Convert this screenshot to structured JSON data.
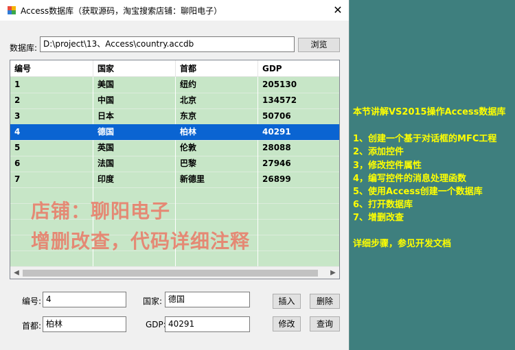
{
  "window": {
    "title": "Access数据库（获取源码，淘宝搜索店铺：聊阳电子）",
    "close_icon": "close-icon"
  },
  "db": {
    "label": "数据库:",
    "path": "D:\\project\\13、Access\\country.accdb",
    "browse_label": "浏览"
  },
  "table": {
    "columns": [
      "编号",
      "国家",
      "首都",
      "GDP"
    ],
    "rows": [
      [
        "1",
        "美国",
        "纽约",
        "205130"
      ],
      [
        "2",
        "中国",
        "北京",
        "134572"
      ],
      [
        "3",
        "日本",
        "东京",
        "50706"
      ],
      [
        "4",
        "德国",
        "柏林",
        "40291"
      ],
      [
        "5",
        "英国",
        "伦敦",
        "28088"
      ],
      [
        "6",
        "法国",
        "巴黎",
        "27946"
      ],
      [
        "7",
        "印度",
        "新德里",
        "26899"
      ]
    ],
    "selected_row": 4,
    "watermark_1": "店铺：聊阳电子",
    "watermark_2": "增删改查，代码详细注释"
  },
  "form": {
    "id_label": "编号:",
    "id_value": "4",
    "country_label": "国家:",
    "country_value": "德国",
    "capital_label": "首都:",
    "capital_value": "柏林",
    "gdp_label": "GDP:",
    "gdp_value": "40291",
    "insert_label": "插入",
    "delete_label": "删除",
    "modify_label": "修改",
    "query_label": "查询"
  },
  "notes": {
    "heading": "本节讲解VS2015操作Access数据库",
    "items": [
      "1、创建一个基于对话框的MFC工程",
      "2、添加控件",
      "3，修改控件属性",
      "4，编写控件的消息处理函数",
      "5、使用Access创建一个数据库",
      "6、打开数据库",
      "7、增删改查"
    ],
    "footer": "详细步骤，参见开发文档"
  },
  "colors": {
    "grid_bg": "#c7e6c7",
    "selection": "#0a64d2",
    "desktop": "#3e7f7e",
    "note_text": "#ffff00",
    "watermark": "#ec6e5c"
  }
}
